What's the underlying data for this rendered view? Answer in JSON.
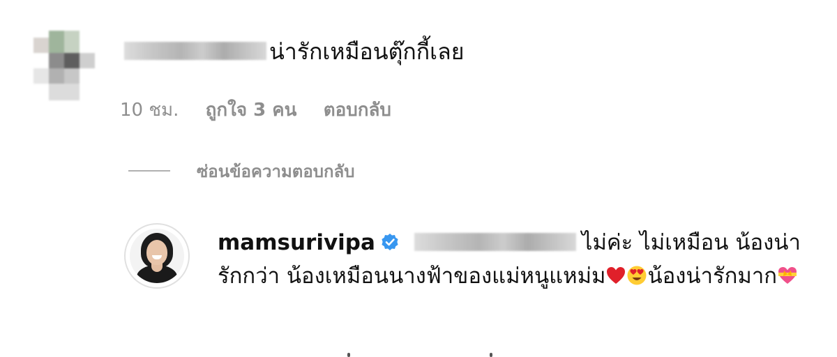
{
  "comment": {
    "text": "น่ารักเหมือนตุ๊กกี้เลย",
    "time": "10 ชม.",
    "likes": "ถูกใจ 3 คน",
    "reply_label": "ตอบกลับ"
  },
  "hide_replies_label": "ซ่อนข้อความตอบกลับ",
  "reply": {
    "username": "mamsurivipa",
    "text": "ไม่ค่ะ ไม่เหมือน น้องน่ารักกว่า น้องเหมือนนางฟ้าของแม่หนูแหม่ม",
    "text_after_emoji": "น้องน่ารักมาก",
    "emojis": [
      "red-heart",
      "heart-eyes-face",
      "heart-with-ribbon"
    ],
    "verified": true
  },
  "colors": {
    "meta_text": "#8e8e8e",
    "verified_blue": "#3897f0",
    "heart_red": "#e0202a"
  }
}
